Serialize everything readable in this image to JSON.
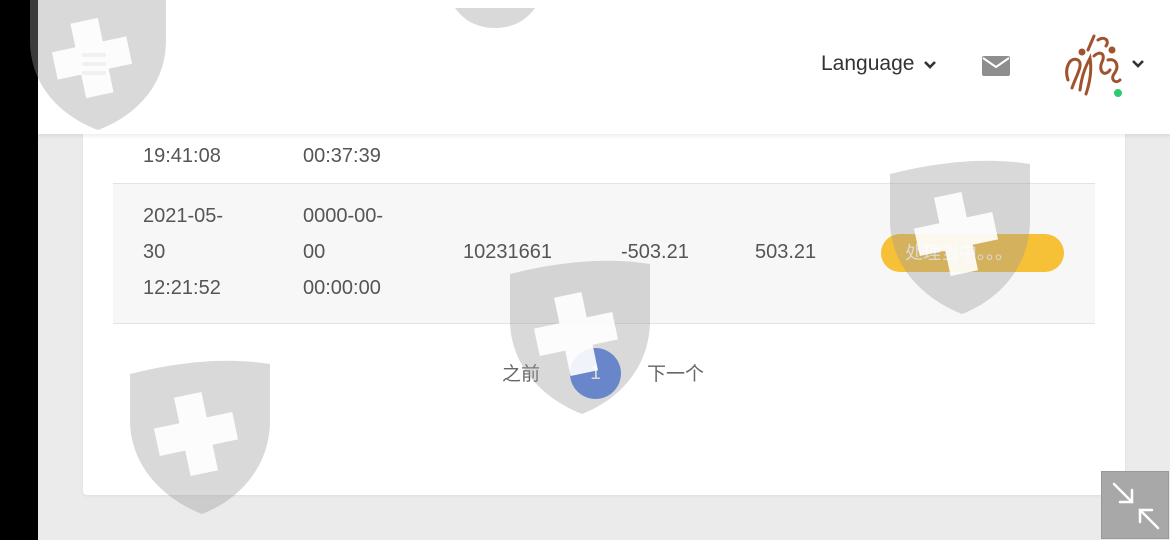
{
  "header": {
    "language_label": "Language",
    "icons": [
      "menu-icon",
      "mail-icon",
      "chevron-down-icon"
    ]
  },
  "table": {
    "partial_row": {
      "col1": "19:41:08",
      "col2": "00:37:39"
    },
    "row": {
      "time1_lines": [
        "2021-05-",
        "30",
        "12:21:52"
      ],
      "time2_lines": [
        "0000-00-",
        "00",
        "00:00:00"
      ],
      "order_no": "10231661",
      "amount": "-503.21",
      "balance": "503.21",
      "status": "处理当中。。。",
      "status_color": "#f7c137"
    }
  },
  "pagination": {
    "prev_label": "之前",
    "current_page": "1",
    "next_label": "下一个",
    "active_color": "#4a7ae6"
  }
}
